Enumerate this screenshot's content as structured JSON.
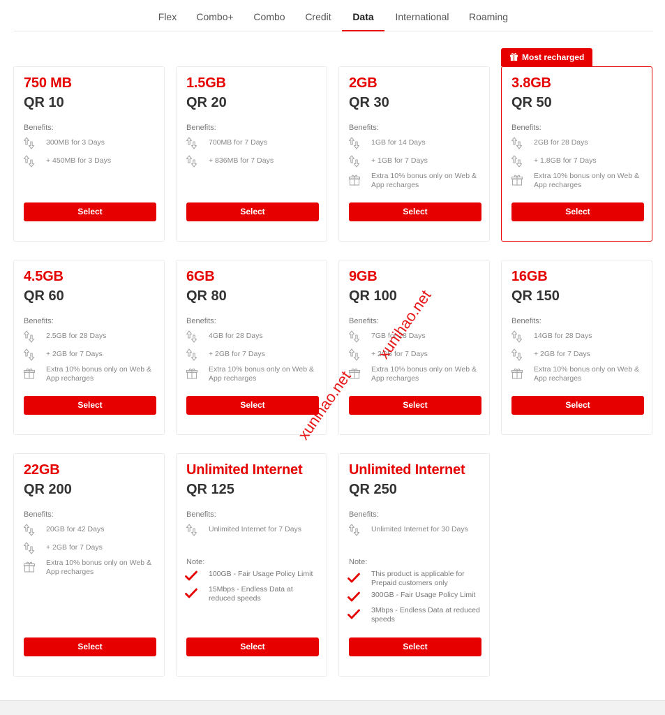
{
  "tabs": [
    "Flex",
    "Combo+",
    "Combo",
    "Credit",
    "Data",
    "International",
    "Roaming"
  ],
  "active_tab": "Data",
  "benefits_label": "Benefits:",
  "note_label": "Note:",
  "select_label": "Select",
  "ribbon_label": "Most recharged",
  "watermark": "xunihao.net",
  "colors": {
    "accent": "#e60000",
    "text": "#333333",
    "muted": "#888888"
  },
  "icons": {
    "benefit": "data-arrows-icon",
    "bonus": "gift-icon",
    "note": "red-check-icon"
  },
  "cards": [
    {
      "volume": "750 MB",
      "price": "QR 10",
      "benefits": [
        "300MB for 3 Days",
        "+ 450MB for 3 Days"
      ]
    },
    {
      "volume": "1.5GB",
      "price": "QR 20",
      "benefits": [
        "700MB for 7 Days",
        "+ 836MB for 7 Days"
      ]
    },
    {
      "volume": "2GB",
      "price": "QR 30",
      "benefits": [
        "1GB for 14 Days",
        "+ 1GB for 7 Days"
      ],
      "bonus": "Extra 10% bonus only on Web & App recharges"
    },
    {
      "volume": "3.8GB",
      "price": "QR 50",
      "benefits": [
        "2GB for 28 Days",
        "+ 1.8GB for 7 Days"
      ],
      "bonus": "Extra 10% bonus only on Web & App recharges",
      "featured": true
    },
    {
      "volume": "4.5GB",
      "price": "QR 60",
      "benefits": [
        "2.5GB for 28 Days",
        "+ 2GB for 7 Days"
      ],
      "bonus": "Extra 10% bonus only on Web & App recharges"
    },
    {
      "volume": "6GB",
      "price": "QR 80",
      "benefits": [
        "4GB for 28 Days",
        "+ 2GB for 7 Days"
      ],
      "bonus": "Extra 10% bonus only on Web & App recharges"
    },
    {
      "volume": "9GB",
      "price": "QR 100",
      "benefits": [
        "7GB for 28 Days",
        "+ 2GB for 7 Days"
      ],
      "bonus": "Extra 10% bonus only on Web & App recharges"
    },
    {
      "volume": "16GB",
      "price": "QR 150",
      "benefits": [
        "14GB for 28 Days",
        "+ 2GB for 7 Days"
      ],
      "bonus": "Extra 10% bonus only on Web & App recharges"
    },
    {
      "volume": "22GB",
      "price": "QR 200",
      "benefits": [
        "20GB for 42 Days",
        "+ 2GB for 7 Days"
      ],
      "bonus": "Extra 10% bonus only on Web & App recharges"
    },
    {
      "volume": "Unlimited Internet",
      "price": "QR 125",
      "benefits": [
        "Unlimited Internet for 7 Days"
      ],
      "notes": [
        "100GB - Fair Usage Policy Limit",
        "15Mbps - Endless Data at reduced speeds"
      ]
    },
    {
      "volume": "Unlimited Internet",
      "price": "QR 250",
      "benefits": [
        "Unlimited Internet for 30 Days"
      ],
      "notes": [
        "This product is applicable for Prepaid customers only",
        "300GB - Fair Usage Policy Limit",
        "3Mbps - Endless Data at reduced speeds"
      ]
    }
  ]
}
